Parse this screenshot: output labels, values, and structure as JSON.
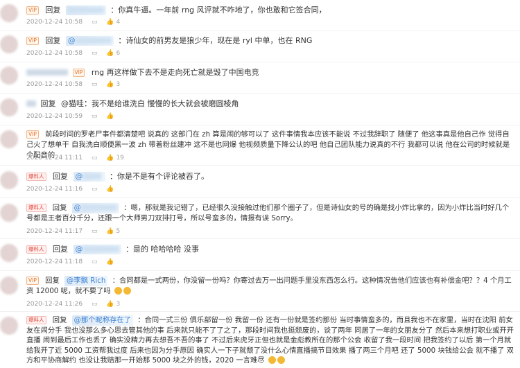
{
  "comments": [
    {
      "badge": "VIP",
      "reply": "回复",
      "text": "：你真牛逼。一年前 rng 风评就不咋地了，你也敢和它签合同，",
      "time": "2020-12-24 10:58",
      "likes": "4"
    },
    {
      "badge": "VIP",
      "reply": "回复",
      "mention": "@",
      "text": "：诗仙女的前男友是狼少年，现在是 ryl 中单，也在 RNG",
      "time": "2020-12-24 10:58",
      "likes": "6"
    },
    {
      "badge": "VIP",
      "text": "rng 再这样做下去不是走向死亡就是毁了中国电竞",
      "time": "2020-12-24 10:58",
      "likes": "3"
    },
    {
      "reply": "回复",
      "text": "@猫哇：我不是给谁洗白 慢慢的长大就会被磨圆棱角",
      "time": "2020-12-24 10:59",
      "likes": ""
    },
    {
      "badge": "VIP",
      "text": "前段时间的罗老尸事件都清楚吧 说真的 这部门在 zh 算是闹的够可以了 这件事情我本应该不能说 不过我辞职了 随便了 他这事真是他自己作 觉得自己火了想单干 自我洗白顺便黑一波 zh 带着粉丝建冲 这不是也网爆 他视频质量下降公认的吧 他自己团队能力说真的不行 我都可以说 他在公司的时候就是个配音的",
      "time": "2020-12-24 11:11",
      "likes": "19"
    },
    {
      "badge": "爆料人",
      "reply": "回复",
      "mention": "@",
      "text": "：你是不是有个评论被吞了。",
      "time": "2020-12-24 11:16",
      "likes": ""
    },
    {
      "badge": "爆料人",
      "reply": "回复",
      "mention": "@",
      "text": "：嗯，那就是我记错了，已经很久没接触过他们那个圈子了，但是诗仙女的号的确是找小炸比拿的，因为小炸比当时好几个号都是王者百分千分，还跟一个大师男刀双排打号，所以号蛮多的，情报有误 Sorry。",
      "time": "2020-12-24 11:17",
      "likes": "5"
    },
    {
      "badge": "爆料人",
      "reply": "回复",
      "mention": "@",
      "text": "：是的 哈哈哈哈 没事",
      "time": "2020-12-24 11:18",
      "likes": ""
    },
    {
      "badge": "VIP",
      "reply": "回复",
      "mention": "@李飘 Rich",
      "text": "：合同都是一式两份，你没留一份吗？你寄过去万一出问题手里没东西怎么行。这种情况告他们应该也有补偿金吧？？4 个月工资 12000 呢，就不要了吗",
      "time": "2020-12-24 11:26",
      "likes": "3"
    },
    {
      "badge": "爆料人",
      "reply": "回复",
      "mention": "@那个昵称存在了",
      "text": "：合同一式三份 俱乐部留一份 我留一份 还有一份就是签约那份 当时事情蛮多的，而且我也不在家里，当时在沈阳 前女友在闹分手 我也没那么多心思去管其他的事 后来就只能不了了之了，那段时间我也挺颓废的，谈了两年 同居了一年的女朋友分了 然后本来想打职业或开开直播 闹到最后工作也丢了 确实没精力再去想吾不吾的事了 不过后来虎牙正但也就是金彪教所在的那个公会 收留了我一段时间 把我签约了以后 第一个月就给我开了近 5000 工资帮我过度 后来也因为分手原因 确实人一下子就颓了没什么心情直播搞节目效果 播了两三个月吧 还了 5000 块钱给公会 就不播了 双方和平协商解约 也没让我赔那一开始那 5000 块之外的钱，2020 一言难尽",
      "time": "",
      "likes": ""
    }
  ],
  "actions": {
    "reply_icon": "comment-icon",
    "like_icon": "thumb-up-icon"
  }
}
